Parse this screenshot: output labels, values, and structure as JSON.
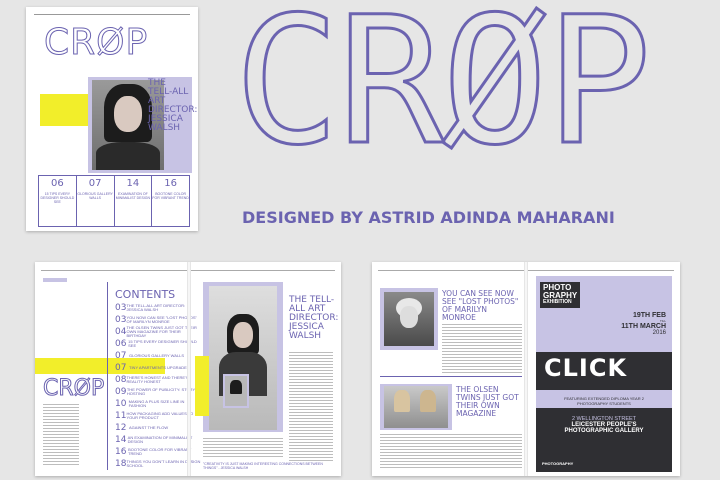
{
  "cover": {
    "logo": "CRØP",
    "headline": "THE TELL-ALL ART DIRECTOR: JESSICA WALSH",
    "features": [
      {
        "num": "06",
        "text": "15 TIPS EVERY DESIGNER SHOULD SEE"
      },
      {
        "num": "07",
        "text": "GLORIOUS GALLERY WALLS"
      },
      {
        "num": "14",
        "text": "EXAMINATION OF MINIMALIST DESIGN"
      },
      {
        "num": "16",
        "text": "BOOTONE COLOR FOR VIBRANT TREND"
      }
    ]
  },
  "title": {
    "logo": "CRØP",
    "credit": "DESIGNED BY ASTRID ADINDA MAHARANI"
  },
  "spread1": {
    "contents_title": "CONTENTS",
    "logo": "CRØP",
    "toc": [
      {
        "num": "03",
        "text": "THE TELL-ALL ART DIRECTOR: JESSICA WALSH"
      },
      {
        "num": "03",
        "text": "YOU NOW CAN SEE \"LOST PHOTOS\" OF MARILYN MONROE"
      },
      {
        "num": "04",
        "text": "THE OLSEN TWINS JUST GOT THEIR OWN MAGAZINE FOR THEIR BIRTHDAY"
      },
      {
        "num": "06",
        "text": "15 TIPS EVERY DESIGNER SHOULD SEE"
      },
      {
        "num": "07",
        "text": "GLORIOUS GALLERY WALLS"
      },
      {
        "num": "07",
        "text": "TINY APARTMENTS UPGRADES"
      },
      {
        "num": "08",
        "text": "THERE'S HONEST AND THERE'S REALITY HONEST"
      },
      {
        "num": "09",
        "text": "THE POWER OF PUBLICITY: STORY HOSTING"
      },
      {
        "num": "10",
        "text": "MAKING A PLUS SIZE LINE IN FASHION"
      },
      {
        "num": "11",
        "text": "HOW PACKAGING ADD VALUES TO YOUR PRODUCT"
      },
      {
        "num": "12",
        "text": "AGAINST THE FLOW"
      },
      {
        "num": "14",
        "text": "AN EXAMINATION OF MINIMALIST DESIGN"
      },
      {
        "num": "16",
        "text": "BOOTONE COLOR FOR VIBRANT TREND"
      },
      {
        "num": "18",
        "text": "THINGS YOU DON'T LEARN IN DESIGN SCHOOL"
      }
    ],
    "feature_headline": "THE TELL-ALL ART DIRECTOR: JESSICA WALSH",
    "quote": "\"CREATIVITY IS JUST MAKING INTERESTING CONNECTIONS BETWEEN THINGS\" - JESSICA WALSH"
  },
  "spread2": {
    "headline1": "YOU CAN SEE NOW SEE \"LOST PHOTOS\" OF MARILYN MONROE",
    "headline2": "THE OLSEN TWINS JUST GOT THEIR OWN MAGAZINE",
    "poster": {
      "title1": "PHOTO",
      "title2": "GRAPHY",
      "title3": "EXHIBITION",
      "date1": "19TH FEB",
      "till": "TILL",
      "date2": "11TH MARCH",
      "year": "2016",
      "click": "CLICK",
      "sub": "FEATURING EXTENDED DIPLOMA YEAR 2 PHOTOGRAPHY STUDENTS",
      "addr1": "2 WELLINGTON STREET",
      "addr2": "LEICESTER PEOPLE'S",
      "addr3": "PHOTOGRAPHIC GALLERY",
      "brand": "PHOTOGRAPHY"
    }
  },
  "colors": {
    "accent": "#6b63b0",
    "highlight": "#f2ee2a",
    "lavender": "#c7c3e4",
    "dark": "#2f2f33"
  }
}
